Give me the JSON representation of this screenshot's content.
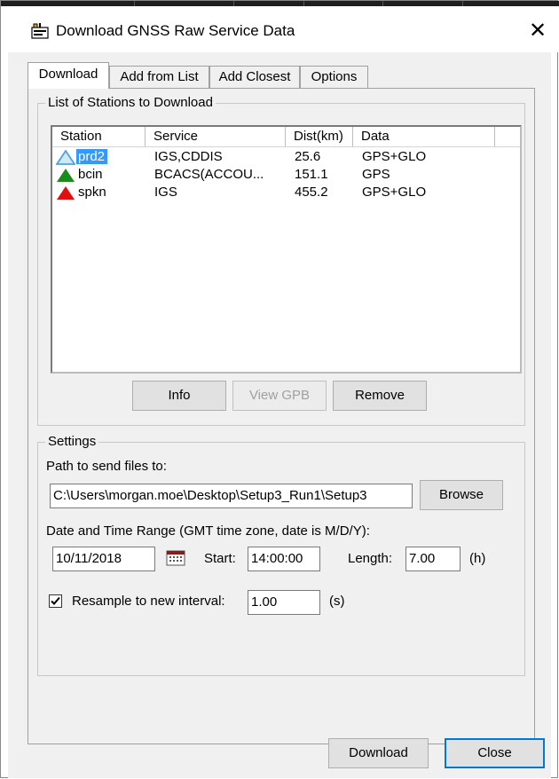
{
  "window": {
    "title": "Download GNSS Raw Service Data",
    "close_glyph": "✕"
  },
  "tabs": [
    {
      "label": "Download",
      "active": true
    },
    {
      "label": "Add from List",
      "active": false
    },
    {
      "label": "Add Closest",
      "active": false
    },
    {
      "label": "Options",
      "active": false
    }
  ],
  "stations_group": {
    "label": "List of Stations to Download",
    "columns": [
      "Station",
      "Service",
      "Dist(km)",
      "Data"
    ],
    "rows": [
      {
        "station": "prd2",
        "service": "IGS,CDDIS",
        "dist": "25.6",
        "data": "GPS+GLO",
        "icon": "triangle-outline-icon",
        "color": "#4aa3df",
        "selected": true
      },
      {
        "station": "bcin",
        "service": "BCACS(ACCOU...",
        "dist": "151.1",
        "data": "GPS",
        "icon": "triangle-green-icon",
        "color": "#1a8c1a",
        "selected": false
      },
      {
        "station": "spkn",
        "service": "IGS",
        "dist": "455.2",
        "data": "GPS+GLO",
        "icon": "triangle-red-icon",
        "color": "#e01010",
        "selected": false
      }
    ],
    "buttons": {
      "info": "Info",
      "view_gpb": "View GPB",
      "remove": "Remove"
    }
  },
  "settings_group": {
    "label": "Settings",
    "path_label": "Path to send files to:",
    "path_value": "C:\\Users\\morgan.moe\\Desktop\\Setup3_Run1\\Setup3",
    "browse_label": "Browse",
    "date_range_label": "Date and Time Range (GMT time zone, date is M/D/Y):",
    "date_value": "10/11/2018",
    "start_label": "Start:",
    "start_value": "14:00:00",
    "length_label": "Length:",
    "length_value": "7.00",
    "length_unit": "(h)",
    "resample_checked": true,
    "resample_label": "Resample to new interval:",
    "resample_value": "1.00",
    "resample_unit": "(s)"
  },
  "footer": {
    "download_label": "Download",
    "close_label": "Close"
  }
}
